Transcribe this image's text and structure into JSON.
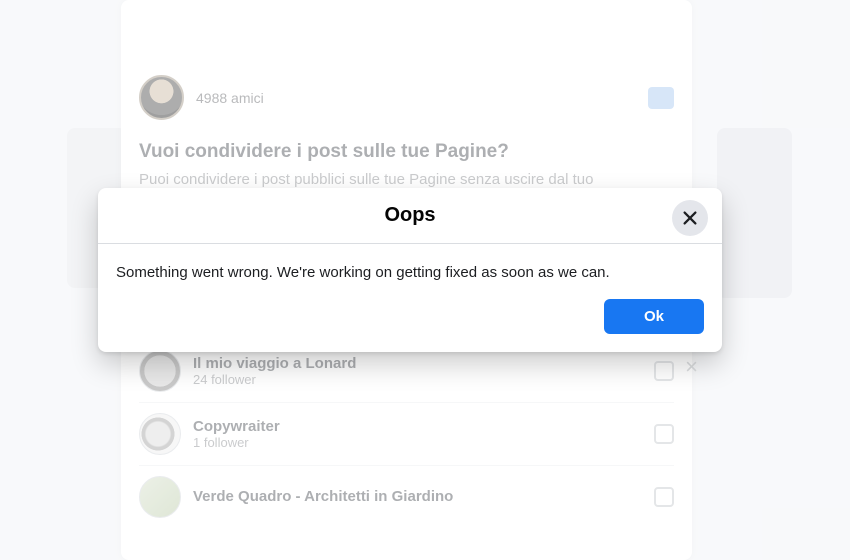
{
  "background": {
    "friend_count_label": "4988 amici",
    "heading": "Vuoi condividere i post sulle tue Pagine?",
    "subheading": "Puoi condividere i post pubblici sulle tue Pagine senza uscire dal tuo",
    "pages": [
      {
        "name": "Il mio viaggio a Lonard",
        "followers": "24 follower"
      },
      {
        "name": "Copywraiter",
        "followers": "1 follower"
      },
      {
        "name": "Verde Quadro - Architetti in Giardino",
        "followers": ""
      }
    ]
  },
  "modal": {
    "title": "Oops",
    "message": "Something went wrong. We're working on getting fixed as soon as we can.",
    "ok_label": "Ok"
  }
}
